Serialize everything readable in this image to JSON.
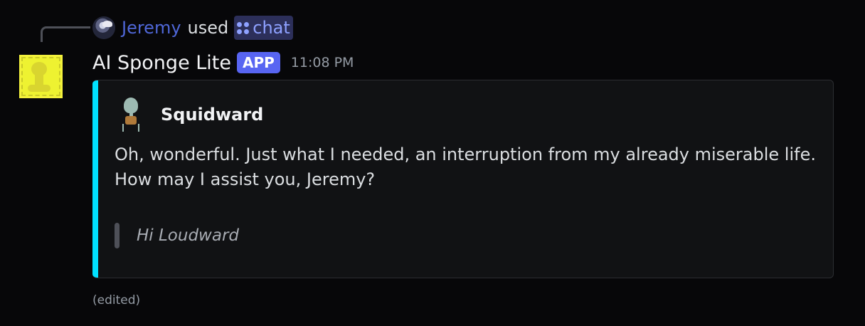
{
  "reply": {
    "username": "Jeremy",
    "used_text": "used",
    "command_name": "chat",
    "user_color": "#4f67d8"
  },
  "message": {
    "bot_name": "AI Sponge Lite",
    "badge": "APP",
    "timestamp": "11:08 PM",
    "edited_label": "(edited)"
  },
  "embed": {
    "accent_color": "#00e1ff",
    "author_name": "Squidward",
    "description": "Oh, wonderful. Just what I needed, an interruption from my already miserable life. How may I assist you, Jeremy?",
    "quote": "Hi Loudward"
  },
  "icons": {
    "reply_avatar": "user-avatar-icon",
    "command": "app-command-icon",
    "bot_avatar": "sponge-avatar-icon",
    "author": "squidward-icon"
  }
}
